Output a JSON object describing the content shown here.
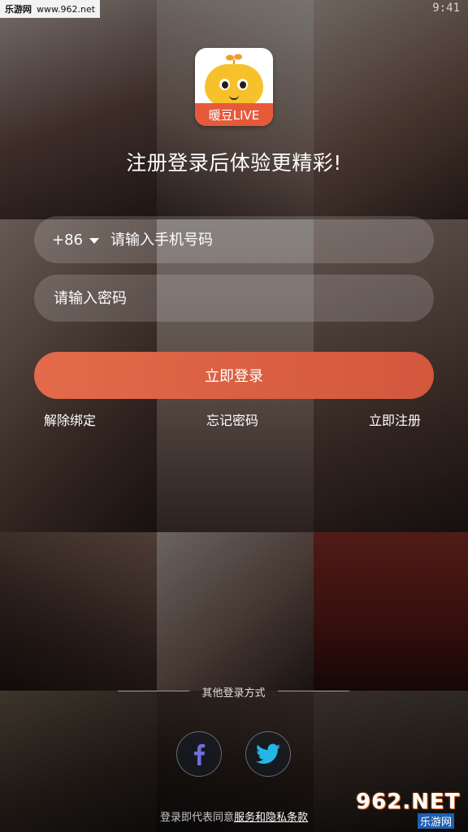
{
  "watermark_top": {
    "left": "乐游网",
    "right": "www.962.net"
  },
  "status": {
    "time": "9:41"
  },
  "logo": {
    "label": "暖豆LIVE",
    "brand_color": "#e65a3a",
    "mascot_color": "#f6c12a"
  },
  "headline": "注册登录后体验更精彩!",
  "phone_field": {
    "country_code": "+86",
    "placeholder": "请输入手机号码"
  },
  "password_field": {
    "placeholder": "请输入密码"
  },
  "login_button": {
    "label": "立即登录",
    "color": "#df6446"
  },
  "links": {
    "unbind": "解除绑定",
    "forgot": "忘记密码",
    "register": "立即注册"
  },
  "other_login": {
    "label": "其他登录方式",
    "providers": [
      "facebook-icon",
      "twitter-icon"
    ],
    "facebook_color": "#6f6fd8",
    "twitter_color": "#23b7e5"
  },
  "terms": {
    "prefix": "登录即代表同意",
    "link": "服务和隐私条款"
  },
  "watermark_bottom": {
    "main": "962.NET",
    "sub": "乐游网"
  }
}
